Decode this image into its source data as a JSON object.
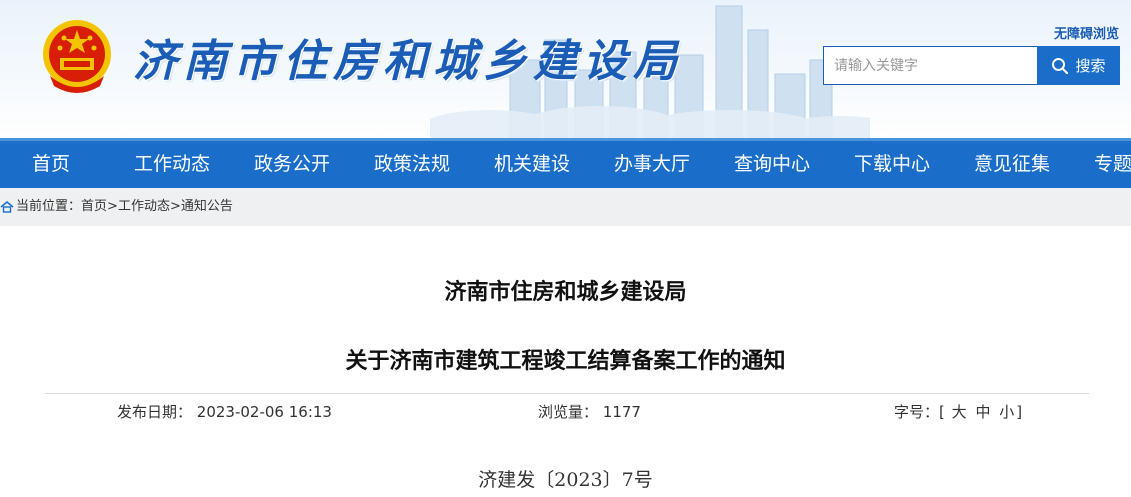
{
  "header": {
    "site_title": "济南市住房和城乡建设局",
    "accessibility_label": "无障碍浏览"
  },
  "search": {
    "placeholder": "请输入关键字",
    "button_label": "搜索"
  },
  "nav": {
    "items": [
      "首页",
      "工作动态",
      "政务公开",
      "政策法规",
      "机关建设",
      "办事大厅",
      "查询中心",
      "下载中心",
      "意见征集",
      "专题"
    ]
  },
  "breadcrumb": {
    "prefix": "当前位置：",
    "items": [
      "首页",
      "工作动态",
      "通知公告"
    ],
    "separator": ">"
  },
  "article": {
    "issuer": "济南市住房和城乡建设局",
    "title": "关于济南市建筑工程竣工结算备案工作的通知",
    "publish_label": "发布日期：",
    "publish_date": "2023-02-06 16:13",
    "views_label": "浏览量：",
    "views": "1177",
    "font_size_label": "字号：",
    "font_sizes": [
      "大",
      "中",
      "小"
    ],
    "doc_number": "济建发〔2023〕7号"
  },
  "colors": {
    "brand_blue": "#1a6ec9",
    "title_blue": "#1a5cb6",
    "emblem_red": "#d81e06",
    "emblem_gold": "#f5c400"
  }
}
